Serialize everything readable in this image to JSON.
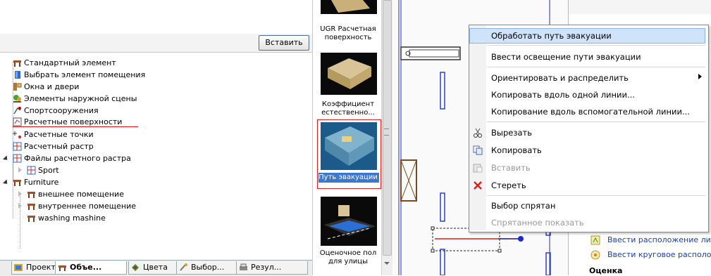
{
  "left_panel": {
    "insert_button": "Вставить",
    "tree": [
      {
        "label": "Стандартный элемент",
        "icon": "furniture-icon"
      },
      {
        "label": "Выбрать элемент помещения",
        "icon": "room-element-icon"
      },
      {
        "label": "Окна и двери",
        "icon": "window-door-icon"
      },
      {
        "label": "Элементы наружной сцены",
        "icon": "outdoor-scene-icon"
      },
      {
        "label": "Спортсооружения",
        "icon": "sport-icon"
      },
      {
        "label": "Расчетные поверхности",
        "icon": "calc-surface-icon"
      },
      {
        "label": "Расчетные точки",
        "icon": "calc-points-icon"
      },
      {
        "label": "Расчетный растр",
        "icon": "calc-grid-icon"
      },
      {
        "label": "Файлы расчетного растра",
        "icon": "calc-grid-files-icon"
      },
      {
        "label": "Sport",
        "icon": "calc-grid-icon"
      },
      {
        "label": "Furniture",
        "icon": "furniture-icon"
      },
      {
        "label": "внешнее помещение",
        "icon": "furniture-icon"
      },
      {
        "label": "внутреннее помещение",
        "icon": "furniture-icon"
      },
      {
        "label": "washing mashine",
        "icon": "furniture-icon"
      }
    ],
    "tabs": [
      {
        "label": "Проект",
        "icon": "project-icon"
      },
      {
        "label": "Объе...",
        "icon": "objects-icon"
      },
      {
        "label": "Цвета",
        "icon": "colors-icon"
      },
      {
        "label": "Выбор...",
        "icon": "selection-icon"
      },
      {
        "label": "Резул...",
        "icon": "results-icon"
      }
    ]
  },
  "thumbnails": [
    {
      "caption_lines": [
        "UGR Расчетная",
        "поверхность"
      ]
    },
    {
      "caption_lines": [
        "Коэффициент",
        "естественно..."
      ]
    },
    {
      "caption_lines": [
        "Путь эвакуации"
      ]
    },
    {
      "caption_lines": [
        "Оценочное пол",
        "для улицы"
      ]
    }
  ],
  "context_menu": {
    "items": [
      {
        "label": "Обработать путь эвакуации",
        "disabled": false,
        "highlighted": true
      },
      {
        "label": "Ввести освещение пути эвакуации",
        "disabled": false
      },
      {
        "label": "Ориентировать и распределить",
        "disabled": false,
        "submenu": true
      },
      {
        "label": "Копировать вдоль одной линии...",
        "disabled": false
      },
      {
        "label": "Копирование вдоль вспомогательной линии...",
        "disabled": false
      },
      {
        "label": "Вырезать",
        "disabled": false,
        "icon": "scissors-icon"
      },
      {
        "label": "Копировать",
        "disabled": false,
        "icon": "copy-icon"
      },
      {
        "label": "Вставить",
        "disabled": true,
        "icon": "paste-icon"
      },
      {
        "label": "Стереть",
        "disabled": false,
        "icon": "delete-x-icon"
      },
      {
        "label": "Выбор спрятан",
        "disabled": false
      },
      {
        "label": "Спрятанное показать",
        "disabled": true
      }
    ]
  },
  "right_panel": {
    "links": [
      "Ввести расположение лин",
      "Ввести круговое располо"
    ],
    "section_heading": "Оценка"
  },
  "colors": {
    "accent": "#2b6fd6",
    "highlight": "#cfe3fa",
    "selection_red": "#e01010"
  }
}
